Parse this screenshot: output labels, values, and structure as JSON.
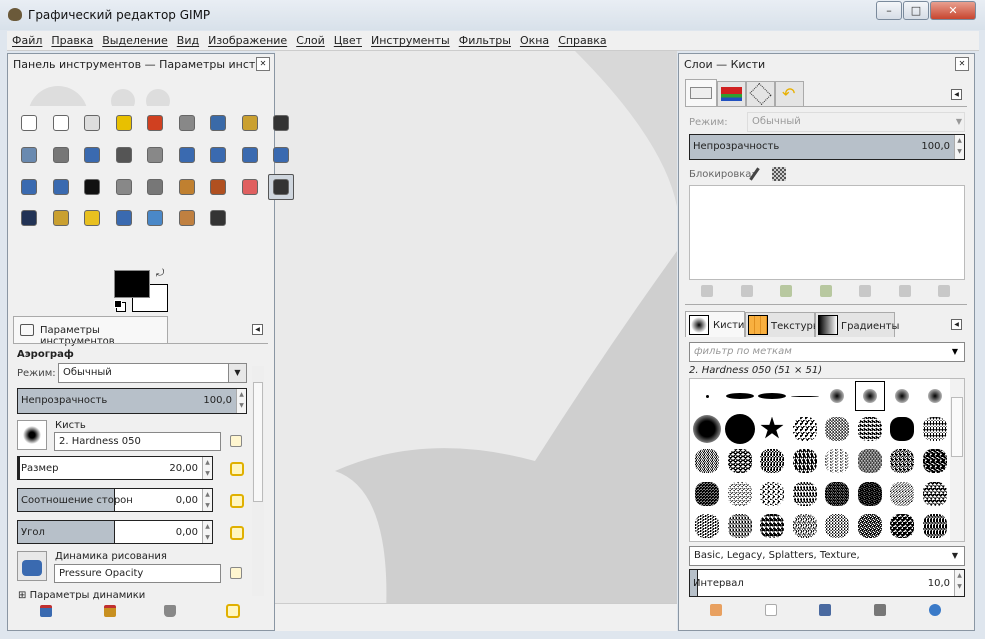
{
  "window": {
    "title": "Графический редактор GIMP",
    "controls": [
      "–",
      "□",
      "✕"
    ]
  },
  "menu": [
    "Файл",
    "Правка",
    "Выделение",
    "Вид",
    "Изображение",
    "Слой",
    "Цвет",
    "Инструменты",
    "Фильтры",
    "Окна",
    "Справка"
  ],
  "toolbox": {
    "title": "Панель инструментов — Параметры инст...",
    "tools": [
      {
        "name": "rect-select",
        "color": "#ffffff"
      },
      {
        "name": "ellipse-select",
        "color": "#ffffff"
      },
      {
        "name": "free-select",
        "color": "#dddddd"
      },
      {
        "name": "fuzzy-select",
        "color": "#e8c000"
      },
      {
        "name": "select-by-color",
        "color": "#d04020"
      },
      {
        "name": "scissors",
        "color": "#888888"
      },
      {
        "name": "foreground-select",
        "color": "#3a6aa8"
      },
      {
        "name": "paths",
        "color": "#caa030"
      },
      {
        "name": "color-picker",
        "color": "#333333"
      },
      {
        "name": "zoom",
        "color": "#6a8ab0"
      },
      {
        "name": "measure",
        "color": "#777777"
      },
      {
        "name": "move",
        "color": "#3a6ab0"
      },
      {
        "name": "align",
        "color": "#555555"
      },
      {
        "name": "crop",
        "color": "#888888"
      },
      {
        "name": "rotate",
        "color": "#3a6ab0"
      },
      {
        "name": "scale",
        "color": "#3a6ab0"
      },
      {
        "name": "shear",
        "color": "#3a6ab0"
      },
      {
        "name": "perspective",
        "color": "#3a6ab0"
      },
      {
        "name": "flip",
        "color": "#3a6ab0"
      },
      {
        "name": "cage-transform",
        "color": "#3a6ab0"
      },
      {
        "name": "text",
        "color": "#111111"
      },
      {
        "name": "bucket-fill",
        "color": "#888888"
      },
      {
        "name": "blend",
        "color": "#777777"
      },
      {
        "name": "pencil",
        "color": "#c08030"
      },
      {
        "name": "paintbrush",
        "color": "#b05020"
      },
      {
        "name": "eraser",
        "color": "#e06060"
      },
      {
        "name": "airbrush",
        "color": "#333333"
      },
      {
        "name": "ink",
        "color": "#223355"
      },
      {
        "name": "clone",
        "color": "#caa030"
      },
      {
        "name": "heal",
        "color": "#e8c020"
      },
      {
        "name": "perspective-clone",
        "color": "#3a6ab0"
      },
      {
        "name": "blur",
        "color": "#4a88c8"
      },
      {
        "name": "smudge",
        "color": "#c08040"
      },
      {
        "name": "dodge-burn",
        "color": "#333333"
      }
    ],
    "active_tool": "airbrush",
    "fg_color": "#000000",
    "bg_color": "#ffffff"
  },
  "tool_options": {
    "tab_label": "Параметры инструментов",
    "tool_name": "Аэрограф",
    "mode_label": "Режим:",
    "mode_value": "Обычный",
    "opacity": {
      "label": "Непрозрачность",
      "value": "100,0",
      "fraction": 1.0
    },
    "brush_label": "Кисть",
    "brush_value": "2. Hardness 050",
    "size": {
      "label": "Размер",
      "value": "20,00",
      "fraction": 0.01
    },
    "aspect": {
      "label": "Соотношение сторон",
      "value": "0,00",
      "fraction": 0.5
    },
    "angle": {
      "label": "Угол",
      "value": "0,00",
      "fraction": 0.5
    },
    "dynamics_label": "Динамика рисования",
    "dynamics_value": "Pressure Opacity",
    "dynamics_options": "Параметры динамики"
  },
  "layers": {
    "title": "Слои — Кисти",
    "mode_label": "Режим:",
    "mode_value": "Обычный",
    "opacity": {
      "label": "Непрозрачность",
      "value": "100,0",
      "fraction": 1.0
    },
    "lock_label": "Блокировка:"
  },
  "brushes": {
    "tabs": [
      "Кисти",
      "Текстуры",
      "Градиенты"
    ],
    "filter_placeholder": "фильтр по меткам",
    "selected": "2. Hardness 050 (51 × 51)",
    "tags": "Basic, Legacy, Splatters, Texture,",
    "spacing": {
      "label": "Интервал",
      "value": "10,0",
      "fraction": 0.05
    }
  }
}
